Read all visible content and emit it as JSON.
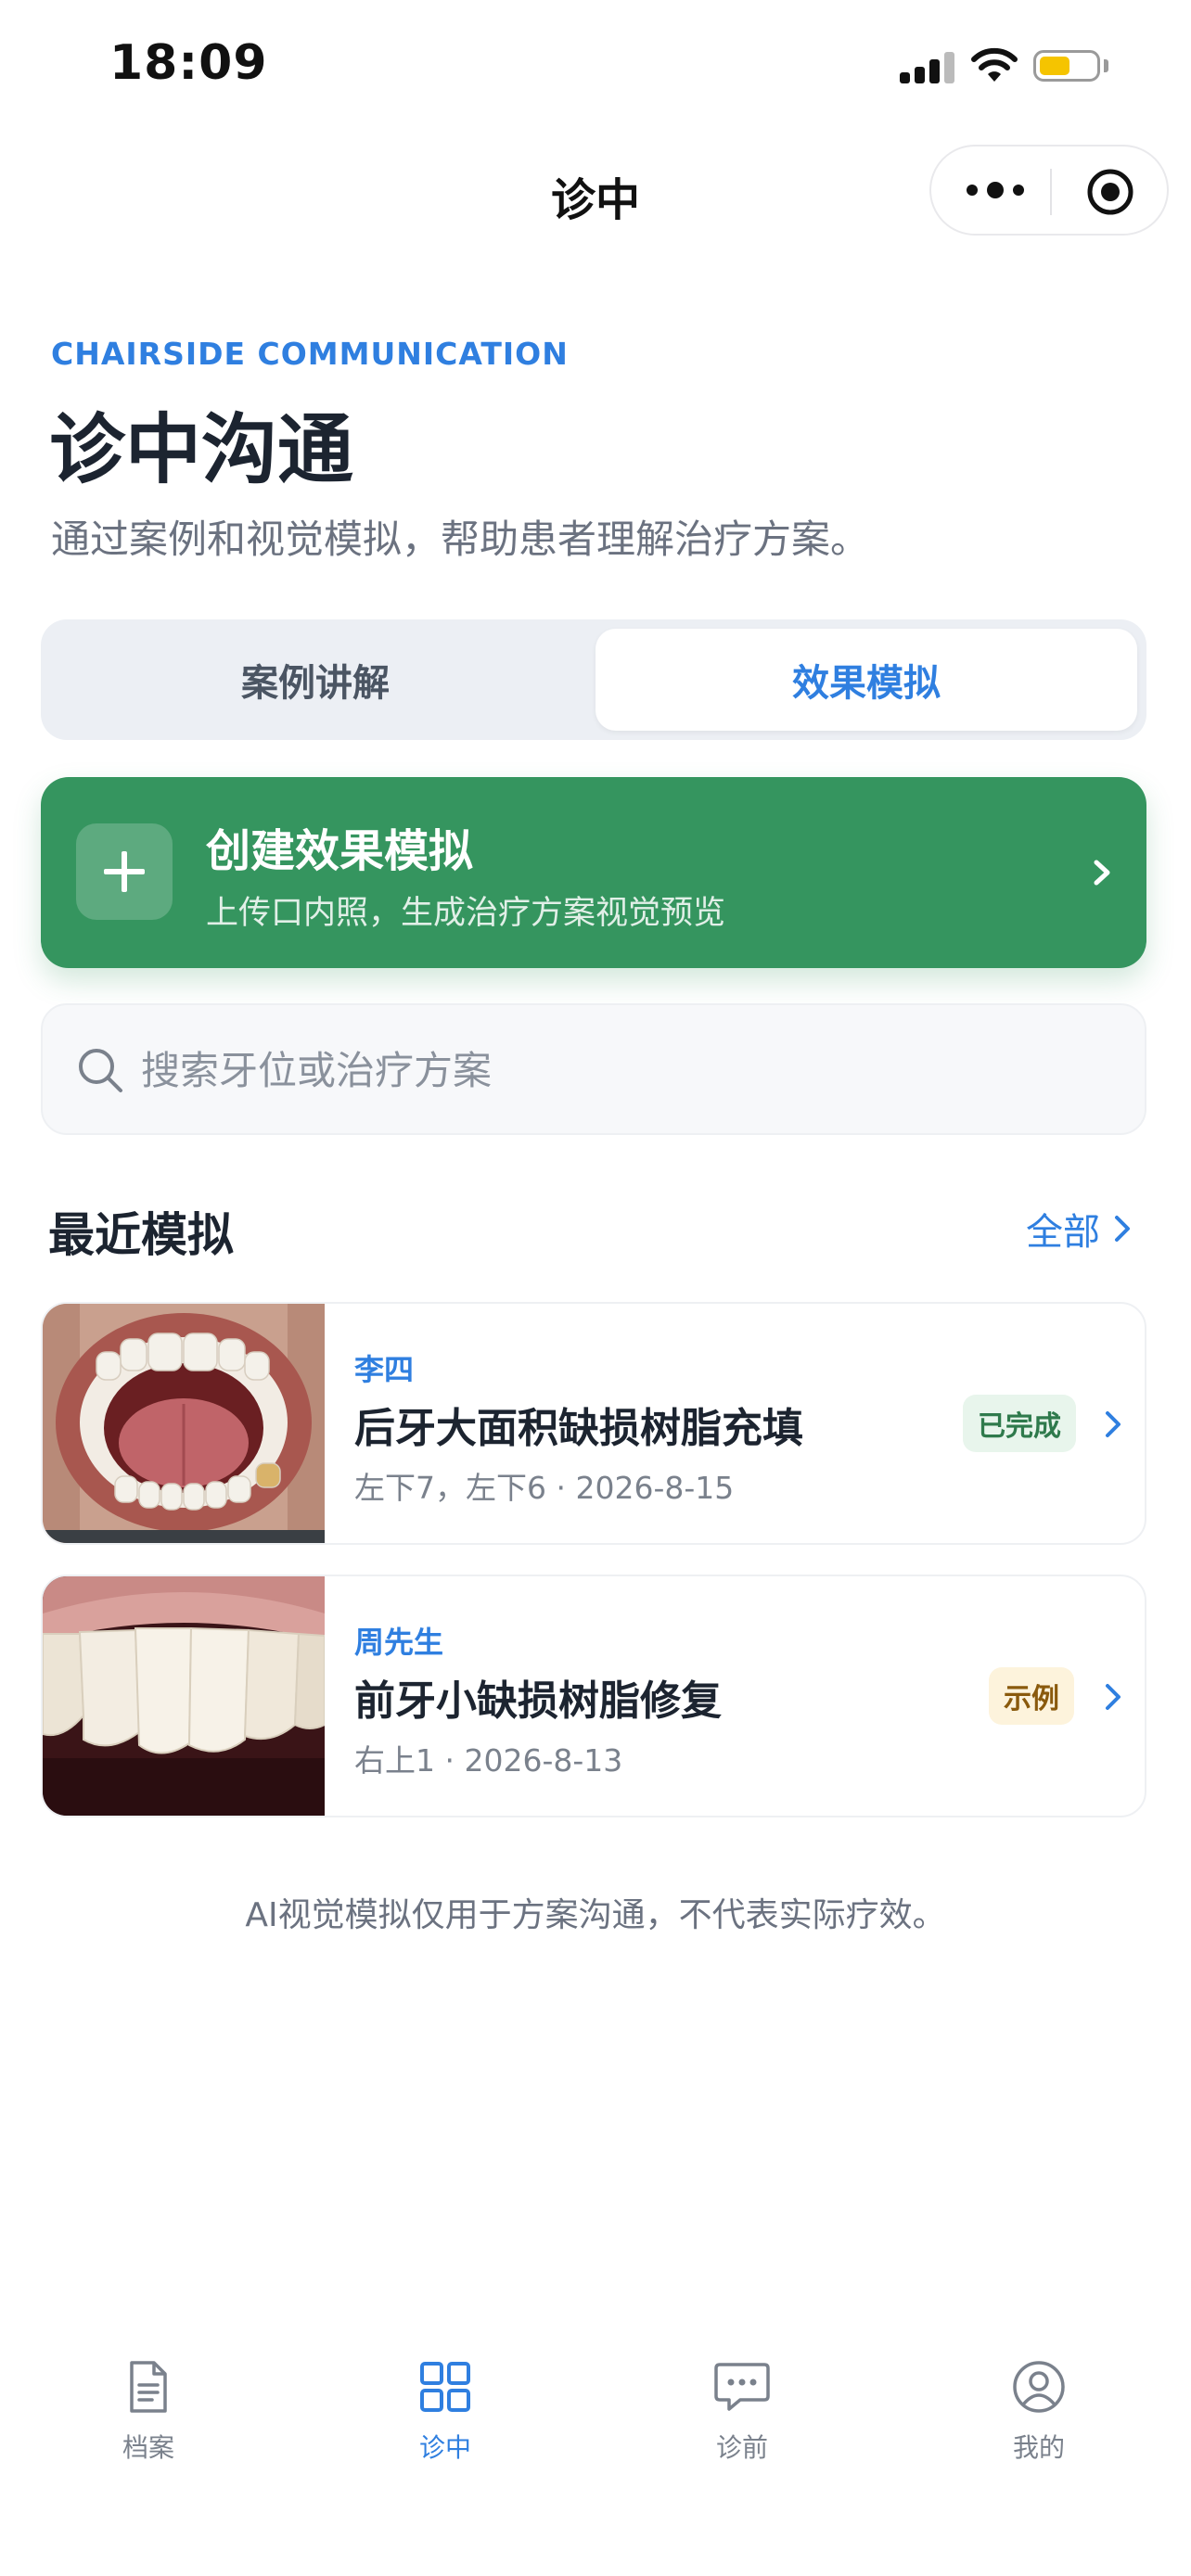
{
  "status_bar": {
    "time": "18:09",
    "battery_level": 0.55
  },
  "nav": {
    "title": "诊中"
  },
  "hero": {
    "eyebrow": "CHAIRSIDE COMMUNICATION",
    "title": "诊中沟通",
    "subtitle": "通过案例和视觉模拟，帮助患者理解治疗方案。"
  },
  "segmented": {
    "tabs": [
      {
        "label": "案例讲解",
        "active": false
      },
      {
        "label": "效果模拟",
        "active": true
      }
    ]
  },
  "create_card": {
    "title": "创建效果模拟",
    "description": "上传口内照，生成治疗方案视觉预览"
  },
  "search": {
    "placeholder": "搜索牙位或治疗方案",
    "value": ""
  },
  "recent": {
    "title": "最近模拟",
    "see_all": "全部",
    "items": [
      {
        "patient": "李四",
        "title": "后牙大面积缺损树脂充填",
        "meta": "左下7，左下6 · 2026-8-15",
        "status": "已完成",
        "status_color": "#2f7a4c"
      },
      {
        "patient": "周先生",
        "title": "前牙小缺损树脂修复",
        "meta": "右上1 · 2026-8-13",
        "status": "示例",
        "status_color": "#8a5a0d"
      }
    ]
  },
  "disclaimer": "AI视觉模拟仅用于方案沟通，不代表实际疗效。",
  "tab_bar": {
    "items": [
      {
        "label": "档案",
        "icon": "document-icon",
        "active": false
      },
      {
        "label": "诊中",
        "icon": "grid-icon",
        "active": true
      },
      {
        "label": "诊前",
        "icon": "chat-icon",
        "active": false
      },
      {
        "label": "我的",
        "icon": "user-icon",
        "active": false
      }
    ]
  },
  "colors": {
    "accent": "#2f7fe0",
    "primary_green": "#35955f",
    "text_primary": "#1c2430",
    "text_secondary": "#6b7280"
  }
}
